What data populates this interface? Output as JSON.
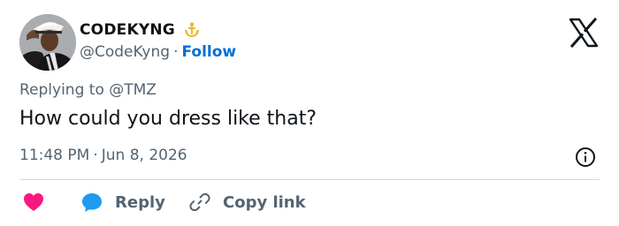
{
  "author": {
    "display_name": "CODEKYNG",
    "handle": "@CodeKyng",
    "separator": "·",
    "follow_label": "Follow"
  },
  "tweet": {
    "replying_prefix": "Replying to",
    "replying_to": "@TMZ",
    "text": "How could you dress like that?",
    "time": "11:48 PM",
    "date_separator": "·",
    "date": "Jun 8, 2026"
  },
  "actions": {
    "reply_label": "Reply",
    "copy_link_label": "Copy link"
  },
  "icons": {
    "logo": "x-logo-icon",
    "badge": "verified-badge-icon",
    "info": "info-icon",
    "like": "heart-icon",
    "reply": "reply-bubble-icon",
    "copy": "link-icon"
  },
  "colors": {
    "text": "#0f1419",
    "secondary": "#536471",
    "follow": "#006fd6",
    "heart": "#f91880",
    "reply_bubble": "#1d9bf0",
    "badge": "#e8b830",
    "divider": "#cfd9de"
  }
}
